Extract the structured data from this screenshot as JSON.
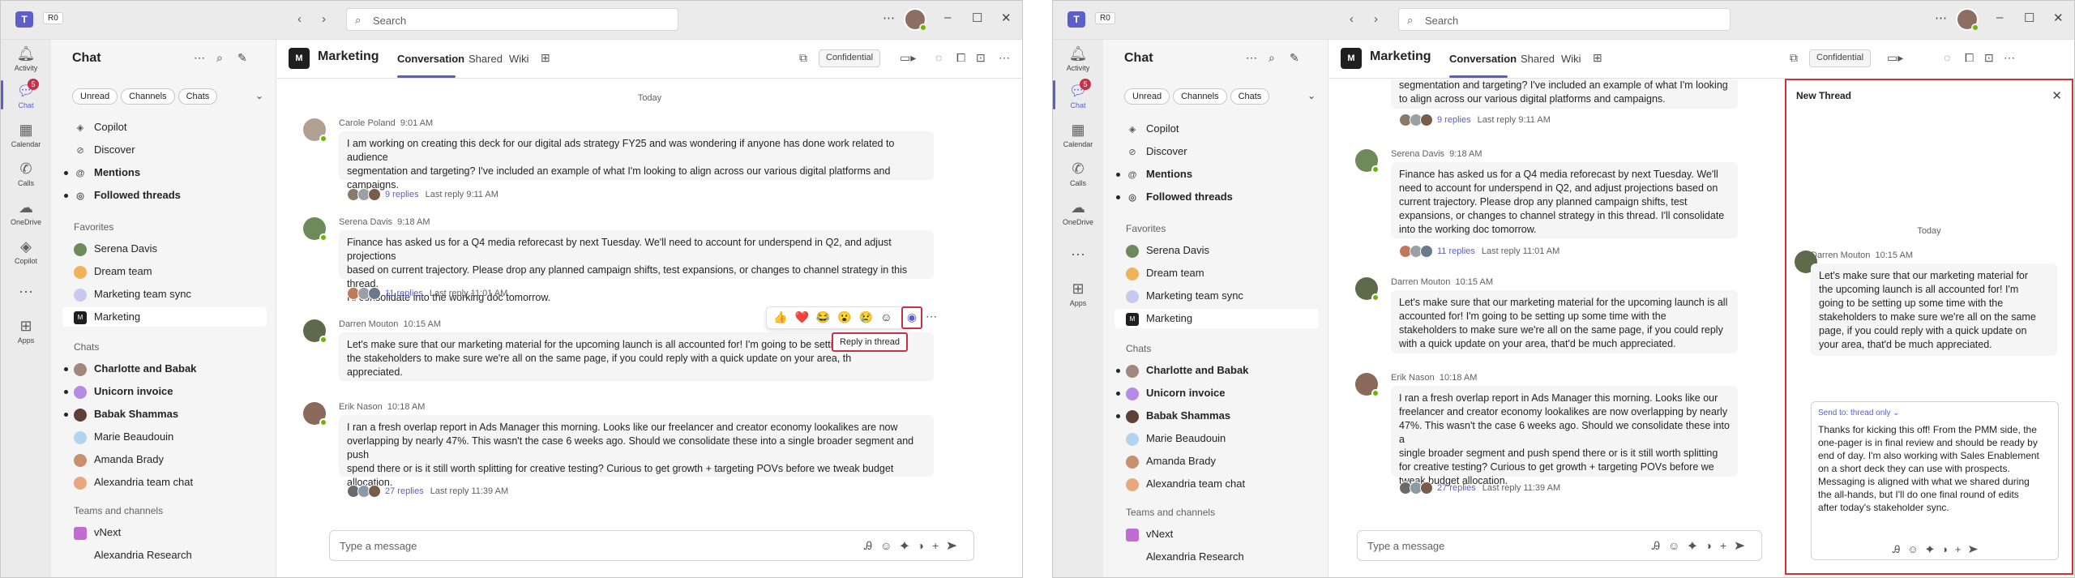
{
  "app": {
    "badge": "R0",
    "search_placeholder": "Search"
  },
  "rail": [
    {
      "label": "Activity",
      "icon": "bell-icon"
    },
    {
      "label": "Chat",
      "icon": "chat-icon",
      "badge": "5"
    },
    {
      "label": "Calendar",
      "icon": "calendar-icon"
    },
    {
      "label": "Calls",
      "icon": "phone-icon"
    },
    {
      "label": "OneDrive",
      "icon": "cloud-icon"
    },
    {
      "label": "Copilot",
      "icon": "copilot-icon"
    },
    {
      "label": "Apps",
      "icon": "apps-icon"
    }
  ],
  "chatlist": {
    "title": "Chat",
    "filters": [
      "Unread",
      "Channels",
      "Chats"
    ],
    "top": [
      "Copilot",
      "Discover",
      "Mentions",
      "Followed threads"
    ],
    "favorites_label": "Favorites",
    "favorites": [
      "Serena Davis",
      "Dream team",
      "Marketing team sync",
      "Marketing"
    ],
    "chats_label": "Chats",
    "chats": [
      "Charlotte and Babak",
      "Unicorn invoice",
      "Babak Shammas",
      "Marie Beaudouin",
      "Amanda Brady",
      "Alexandria team chat"
    ],
    "teams_label": "Teams and channels",
    "teams": [
      "vNext",
      "Alexandria Research"
    ]
  },
  "channel": {
    "logo": "M",
    "title": "Marketing",
    "tabs": [
      "Conversation",
      "Shared",
      "Wiki"
    ],
    "confidential": "Confidential"
  },
  "feed": {
    "today": "Today",
    "messages": [
      {
        "author": "Carole Poland",
        "time": "9:01 AM",
        "text": "I am working on creating this deck for our digital ads strategy FY25 and was wondering if anyone has done work related to audience segmentation and targeting? I've included an example of what I'm looking to align across our various digital platforms and campaigns.",
        "replies": "9 replies",
        "last": "Last reply 9:11 AM"
      },
      {
        "author": "Serena Davis",
        "time": "9:18 AM",
        "text": "Finance has asked us for a Q4 media reforecast by next Tuesday. We'll need to account for underspend in Q2, and adjust projections based on current trajectory. Please drop any planned campaign shifts, test expansions, or changes to channel strategy in this thread. I'll consolidate into the working doc tomorrow.",
        "replies": "11 replies",
        "last": "Last reply 11:01 AM"
      },
      {
        "author": "Darren Mouton",
        "time": "10:15 AM",
        "text": "Let's make sure that our marketing material for the upcoming launch is all accounted for! I'm going to be setting up some time with the stakeholders to make sure we're all on the same page, if you could reply with a quick update on your area, that'd be much appreciated."
      },
      {
        "author": "Erik Nason",
        "time": "10:18 AM",
        "text": "I ran a fresh overlap report in Ads Manager this morning. Looks like our freelancer and creator economy lookalikes are now overlapping by nearly 47%. This wasn't the case 6 weeks ago. Should we consolidate these into a single broader segment and push spend there or is it still worth splitting for creative testing? Curious to get growth + targeting POVs before we tweak budget allocation.",
        "replies": "27 replies",
        "last": "Last reply 11:39 AM"
      }
    ],
    "p1_lines": [
      [
        "I am working on creating this deck for our digital ads strategy FY25 and was wondering if anyone has done work related to audience",
        "segmentation and targeting? I've included an example of what I'm looking to align across our various digital platforms and",
        "campaigns."
      ],
      [
        "Finance has asked us for a Q4 media reforecast by next Tuesday. We'll need to account for underspend in Q2, and adjust projections",
        "based on current trajectory. Please drop any planned campaign shifts, test expansions, or changes to channel strategy in this thread.",
        "I'll consolidate into the working doc tomorrow."
      ],
      [
        "Let's make sure that our marketing material for the upcoming launch is all accounted for! I'm going to be setti",
        "the stakeholders to make sure we're all on the same page, if you could reply with a quick update on your area, th",
        "appreciated."
      ],
      [
        "I ran a fresh overlap report in Ads Manager this morning. Looks like our freelancer and creator economy lookalikes are now",
        "overlapping by nearly 47%. This wasn't the case 6 weeks ago. Should we consolidate these into a single broader segment and push",
        "spend there or is it still worth splitting for creative testing? Curious to get growth + targeting POVs before we tweak budget",
        "allocation."
      ]
    ],
    "p2_first_lines": [
      "segmentation and targeting? I've included an example of what I'm looking",
      "to align across our various digital platforms and campaigns."
    ],
    "p2_lines": [
      [
        "Finance has asked us for a Q4 media reforecast by next Tuesday. We'll",
        "need to account for underspend in Q2, and adjust projections based on",
        "current trajectory. Please drop any planned campaign shifts, test",
        "expansions, or changes to channel strategy in this thread. I'll consolidate",
        "into the working doc tomorrow."
      ],
      [
        "Let's make sure that our marketing material for the upcoming launch is all",
        "accounted for! I'm going to be setting up some time with the",
        "stakeholders to make sure we're all on the same page, if you could reply",
        "with a quick update on your area, that'd be much appreciated."
      ],
      [
        "I ran a fresh overlap report in Ads Manager this morning. Looks like our",
        "freelancer and creator economy lookalikes are now overlapping by nearly",
        "47%. This wasn't the case 6 weeks ago. Should we consolidate these into a",
        "single broader segment and push spend there or is it still worth splitting",
        "for creative testing? Curious to get growth + targeting POVs before we",
        "tweak budget allocation."
      ]
    ],
    "reactions": [
      "👍",
      "❤️",
      "😂",
      "😮",
      "😢"
    ],
    "tooltip": "Reply in thread"
  },
  "compose": {
    "placeholder": "Type a message"
  },
  "thread": {
    "title": "New Thread",
    "today": "Today",
    "author": "Darren Mouton",
    "time": "10:15 AM",
    "lines": [
      "Let's make sure that our marketing material for",
      "the upcoming launch is all accounted for! I'm",
      "going to be setting up some time with the",
      "stakeholders to make sure we're all on the same",
      "page, if you could reply with a quick update on",
      "your area, that'd be much appreciated."
    ],
    "send_to": "Send to: thread only",
    "reply_lines": [
      "Thanks for kicking this off! From the PMM side, the",
      "one-pager is in final review and should be ready by",
      "end of day. I'm also working with Sales Enablement",
      "on a short deck they can use with prospects.",
      "Messaging is aligned with what we shared during",
      "the all-hands, but I'll do one final round of edits",
      "after today's stakeholder sync."
    ]
  },
  "colors": {
    "brand": "#5b5fc7",
    "highlight": "#c4314b",
    "presence": "#6bb700"
  }
}
